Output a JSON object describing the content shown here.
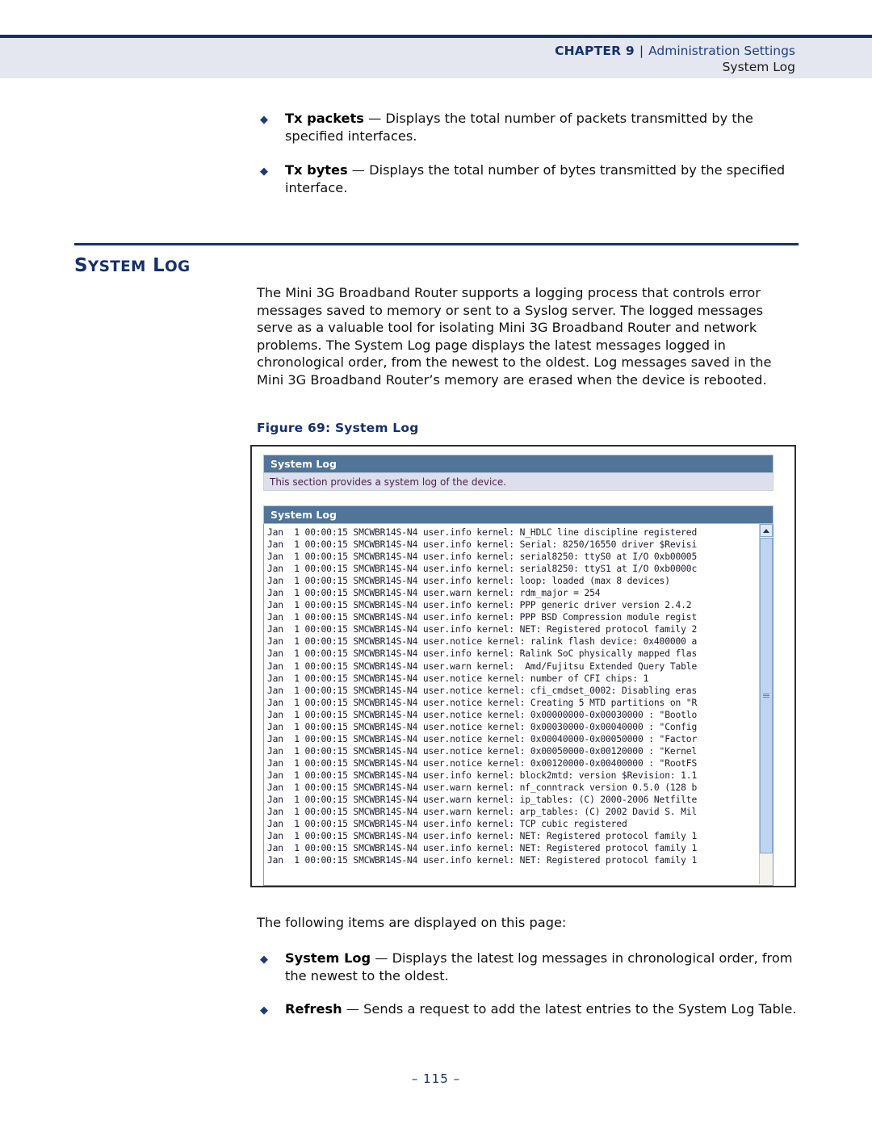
{
  "header": {
    "chapter_label": "CHAPTER 9",
    "separator": "|",
    "chapter_title": "Administration Settings",
    "subtitle": "System Log"
  },
  "top_bullets": [
    {
      "term": "Tx packets",
      "dash": " — ",
      "text": "Displays the total number of packets transmitted by the specified interfaces."
    },
    {
      "term": "Tx bytes",
      "dash": " — ",
      "text": "Displays the total number of bytes transmitted by the specified interface."
    }
  ],
  "section": {
    "heading": "SYSTEM LOG",
    "intro": "The Mini 3G Broadband Router supports a logging process that controls error messages saved to memory or sent to a Syslog server. The logged messages serve as a valuable tool for isolating Mini 3G Broadband Router and network problems. The System Log page displays the latest messages logged in chronological order, from the newest to the oldest. Log messages saved in the Mini 3G Broadband Router’s memory are erased when the device is rebooted."
  },
  "figure": {
    "caption": "Figure 69:  System Log",
    "panel_title": "System Log",
    "panel_description": "This section provides a system log of the device.",
    "log_panel_title": "System Log",
    "log_lines": [
      "Jan  1 00:00:15 SMCWBR14S-N4 user.info kernel: N_HDLC line discipline registered",
      "Jan  1 00:00:15 SMCWBR14S-N4 user.info kernel: Serial: 8250/16550 driver $Revisi",
      "Jan  1 00:00:15 SMCWBR14S-N4 user.info kernel: serial8250: ttyS0 at I/O 0xb00005",
      "Jan  1 00:00:15 SMCWBR14S-N4 user.info kernel: serial8250: ttyS1 at I/O 0xb0000c",
      "Jan  1 00:00:15 SMCWBR14S-N4 user.info kernel: loop: loaded (max 8 devices)",
      "Jan  1 00:00:15 SMCWBR14S-N4 user.warn kernel: rdm_major = 254",
      "Jan  1 00:00:15 SMCWBR14S-N4 user.info kernel: PPP generic driver version 2.4.2",
      "Jan  1 00:00:15 SMCWBR14S-N4 user.info kernel: PPP BSD Compression module regist",
      "Jan  1 00:00:15 SMCWBR14S-N4 user.info kernel: NET: Registered protocol family 2",
      "Jan  1 00:00:15 SMCWBR14S-N4 user.notice kernel: ralink flash device: 0x400000 a",
      "Jan  1 00:00:15 SMCWBR14S-N4 user.info kernel: Ralink SoC physically mapped flas",
      "Jan  1 00:00:15 SMCWBR14S-N4 user.warn kernel:  Amd/Fujitsu Extended Query Table",
      "Jan  1 00:00:15 SMCWBR14S-N4 user.notice kernel: number of CFI chips: 1",
      "Jan  1 00:00:15 SMCWBR14S-N4 user.notice kernel: cfi_cmdset_0002: Disabling eras",
      "Jan  1 00:00:15 SMCWBR14S-N4 user.notice kernel: Creating 5 MTD partitions on \"R",
      "Jan  1 00:00:15 SMCWBR14S-N4 user.notice kernel: 0x00000000-0x00030000 : \"Bootlo",
      "Jan  1 00:00:15 SMCWBR14S-N4 user.notice kernel: 0x00030000-0x00040000 : \"Config",
      "Jan  1 00:00:15 SMCWBR14S-N4 user.notice kernel: 0x00040000-0x00050000 : \"Factor",
      "Jan  1 00:00:15 SMCWBR14S-N4 user.notice kernel: 0x00050000-0x00120000 : \"Kernel",
      "Jan  1 00:00:15 SMCWBR14S-N4 user.notice kernel: 0x00120000-0x00400000 : \"RootFS",
      "Jan  1 00:00:15 SMCWBR14S-N4 user.info kernel: block2mtd: version $Revision: 1.1",
      "Jan  1 00:00:15 SMCWBR14S-N4 user.warn kernel: nf_conntrack version 0.5.0 (128 b",
      "Jan  1 00:00:15 SMCWBR14S-N4 user.warn kernel: ip_tables: (C) 2000-2006 Netfilte",
      "Jan  1 00:00:15 SMCWBR14S-N4 user.warn kernel: arp_tables: (C) 2002 David S. Mil",
      "Jan  1 00:00:15 SMCWBR14S-N4 user.info kernel: TCP cubic registered",
      "Jan  1 00:00:15 SMCWBR14S-N4 user.info kernel: NET: Registered protocol family 1",
      "Jan  1 00:00:15 SMCWBR14S-N4 user.info kernel: NET: Registered protocol family 1",
      "Jan  1 00:00:15 SMCWBR14S-N4 user.info kernel: NET: Registered protocol family 1"
    ]
  },
  "lower": {
    "intro_line": "The following items are displayed on this page:",
    "bullets": [
      {
        "term": "System Log",
        "dash": " — ",
        "text": "Displays the latest log messages in chronological order, from the newest to the oldest."
      },
      {
        "term": "Refresh",
        "dash": " — ",
        "text": "Sends a request to add the latest entries to the System Log Table."
      }
    ]
  },
  "page_number": "–  115  –",
  "colors": {
    "navy": "#15306d",
    "header_band": "#e4e7ef",
    "panel_header": "#517499",
    "panel_desc_bg": "#dde0ec",
    "scroll_thumb": "#bed4f0"
  }
}
